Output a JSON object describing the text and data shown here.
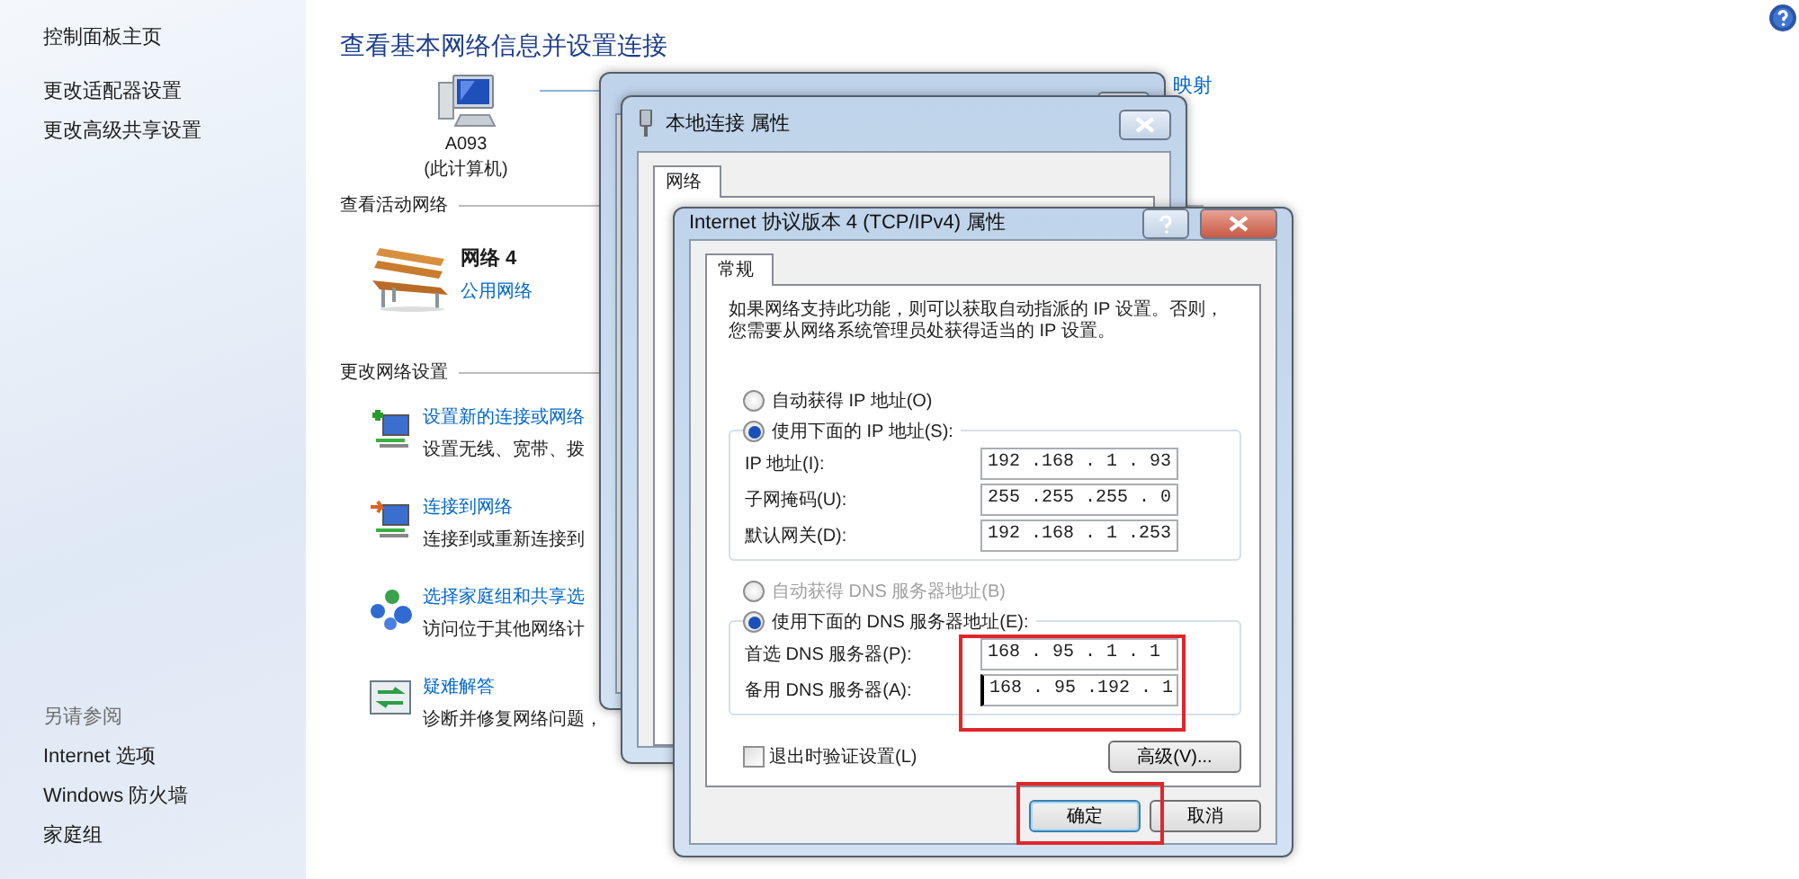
{
  "sidebar": {
    "links": [
      {
        "label": "控制面板主页"
      },
      {
        "label": "更改适配器设置"
      },
      {
        "label": "更改高级共享设置"
      }
    ],
    "see_also_heading": "另请参阅",
    "see_also": [
      {
        "label": "Internet 选项"
      },
      {
        "label": "Windows 防火墙"
      },
      {
        "label": "家庭组"
      }
    ]
  },
  "main": {
    "title": "查看基本网络信息并设置连接",
    "computer": {
      "name": "A093",
      "caption": "(此计算机)"
    },
    "map_link": "映射",
    "active_heading": "查看活动网络",
    "network": {
      "name": "网络 4",
      "type": "公用网络"
    },
    "settings_heading": "更改网络设置",
    "tasks": [
      {
        "kind": "new-connection",
        "link": "设置新的连接或网络",
        "description": "设置无线、宽带、拨"
      },
      {
        "kind": "connect",
        "link": "连接到网络",
        "description": "连接到或重新连接到"
      },
      {
        "kind": "homegroup",
        "link": "选择家庭组和共享选",
        "description": "访问位于其他网络计"
      },
      {
        "kind": "troubleshoot",
        "link": "疑难解答",
        "description": "诊断并修复网络问题，"
      }
    ]
  },
  "windows": [
    {
      "title": "本地连接 属性",
      "tabs": [
        {
          "label": "网络",
          "selected": true
        }
      ]
    },
    {
      "title": "Internet 协议版本 4 (TCP/IPv4) 属性",
      "tabs": [
        {
          "label": "常规",
          "selected": true
        }
      ],
      "intro": "如果网络支持此功能，则可以获取自动指派的 IP 设置。否则，您需要从网络系统管理员处获得适当的 IP 设置。",
      "ip_options": [
        {
          "label": "自动获得 IP 地址(O)",
          "selected": false,
          "disabled": false
        },
        {
          "label": "使用下面的 IP 地址(S):",
          "selected": true,
          "disabled": false
        }
      ],
      "ip_fields": [
        {
          "label": "IP 地址(I):",
          "value": "192 .168 . 1 . 93"
        },
        {
          "label": "子网掩码(U):",
          "value": "255 .255 .255 . 0"
        },
        {
          "label": "默认网关(D):",
          "value": "192 .168 . 1 .253"
        }
      ],
      "dns_options": [
        {
          "label": "自动获得 DNS 服务器地址(B)",
          "selected": false,
          "disabled": true
        },
        {
          "label": "使用下面的 DNS 服务器地址(E):",
          "selected": true,
          "disabled": false
        }
      ],
      "dns_fields": [
        {
          "label": "首选 DNS 服务器(P):",
          "value": "168 . 95 . 1 . 1",
          "focused": false
        },
        {
          "label": "备用 DNS 服务器(A):",
          "value": "168 . 95 .192 . 1",
          "focused": true
        }
      ],
      "dns_highlighted": true,
      "validate": {
        "label": "退出时验证设置(L)",
        "checked": false
      },
      "buttons": [
        {
          "kind": "advanced",
          "label": "高级(V)..."
        },
        {
          "kind": "ok",
          "label": "确定",
          "highlighted": true
        },
        {
          "kind": "cancel",
          "label": "取消"
        }
      ]
    }
  ]
}
